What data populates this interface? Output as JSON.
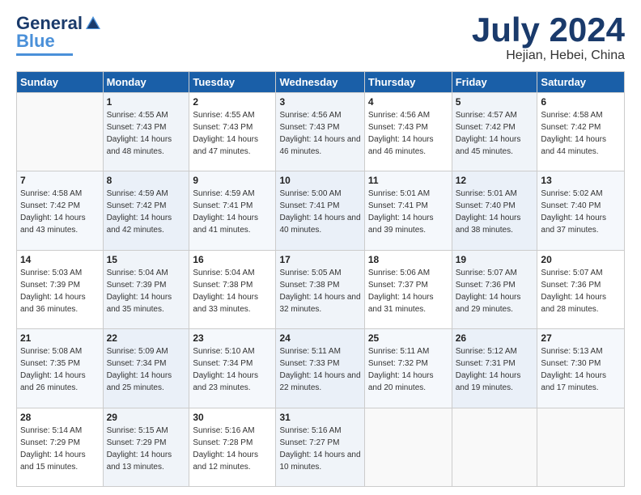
{
  "logo": {
    "line1": "General",
    "line2": "Blue"
  },
  "title": "July 2024",
  "location": "Hejian, Hebei, China",
  "days_header": [
    "Sunday",
    "Monday",
    "Tuesday",
    "Wednesday",
    "Thursday",
    "Friday",
    "Saturday"
  ],
  "weeks": [
    [
      {
        "num": "",
        "sunrise": "",
        "sunset": "",
        "daylight": ""
      },
      {
        "num": "1",
        "sunrise": "Sunrise: 4:55 AM",
        "sunset": "Sunset: 7:43 PM",
        "daylight": "Daylight: 14 hours and 48 minutes."
      },
      {
        "num": "2",
        "sunrise": "Sunrise: 4:55 AM",
        "sunset": "Sunset: 7:43 PM",
        "daylight": "Daylight: 14 hours and 47 minutes."
      },
      {
        "num": "3",
        "sunrise": "Sunrise: 4:56 AM",
        "sunset": "Sunset: 7:43 PM",
        "daylight": "Daylight: 14 hours and 46 minutes."
      },
      {
        "num": "4",
        "sunrise": "Sunrise: 4:56 AM",
        "sunset": "Sunset: 7:43 PM",
        "daylight": "Daylight: 14 hours and 46 minutes."
      },
      {
        "num": "5",
        "sunrise": "Sunrise: 4:57 AM",
        "sunset": "Sunset: 7:42 PM",
        "daylight": "Daylight: 14 hours and 45 minutes."
      },
      {
        "num": "6",
        "sunrise": "Sunrise: 4:58 AM",
        "sunset": "Sunset: 7:42 PM",
        "daylight": "Daylight: 14 hours and 44 minutes."
      }
    ],
    [
      {
        "num": "7",
        "sunrise": "Sunrise: 4:58 AM",
        "sunset": "Sunset: 7:42 PM",
        "daylight": "Daylight: 14 hours and 43 minutes."
      },
      {
        "num": "8",
        "sunrise": "Sunrise: 4:59 AM",
        "sunset": "Sunset: 7:42 PM",
        "daylight": "Daylight: 14 hours and 42 minutes."
      },
      {
        "num": "9",
        "sunrise": "Sunrise: 4:59 AM",
        "sunset": "Sunset: 7:41 PM",
        "daylight": "Daylight: 14 hours and 41 minutes."
      },
      {
        "num": "10",
        "sunrise": "Sunrise: 5:00 AM",
        "sunset": "Sunset: 7:41 PM",
        "daylight": "Daylight: 14 hours and 40 minutes."
      },
      {
        "num": "11",
        "sunrise": "Sunrise: 5:01 AM",
        "sunset": "Sunset: 7:41 PM",
        "daylight": "Daylight: 14 hours and 39 minutes."
      },
      {
        "num": "12",
        "sunrise": "Sunrise: 5:01 AM",
        "sunset": "Sunset: 7:40 PM",
        "daylight": "Daylight: 14 hours and 38 minutes."
      },
      {
        "num": "13",
        "sunrise": "Sunrise: 5:02 AM",
        "sunset": "Sunset: 7:40 PM",
        "daylight": "Daylight: 14 hours and 37 minutes."
      }
    ],
    [
      {
        "num": "14",
        "sunrise": "Sunrise: 5:03 AM",
        "sunset": "Sunset: 7:39 PM",
        "daylight": "Daylight: 14 hours and 36 minutes."
      },
      {
        "num": "15",
        "sunrise": "Sunrise: 5:04 AM",
        "sunset": "Sunset: 7:39 PM",
        "daylight": "Daylight: 14 hours and 35 minutes."
      },
      {
        "num": "16",
        "sunrise": "Sunrise: 5:04 AM",
        "sunset": "Sunset: 7:38 PM",
        "daylight": "Daylight: 14 hours and 33 minutes."
      },
      {
        "num": "17",
        "sunrise": "Sunrise: 5:05 AM",
        "sunset": "Sunset: 7:38 PM",
        "daylight": "Daylight: 14 hours and 32 minutes."
      },
      {
        "num": "18",
        "sunrise": "Sunrise: 5:06 AM",
        "sunset": "Sunset: 7:37 PM",
        "daylight": "Daylight: 14 hours and 31 minutes."
      },
      {
        "num": "19",
        "sunrise": "Sunrise: 5:07 AM",
        "sunset": "Sunset: 7:36 PM",
        "daylight": "Daylight: 14 hours and 29 minutes."
      },
      {
        "num": "20",
        "sunrise": "Sunrise: 5:07 AM",
        "sunset": "Sunset: 7:36 PM",
        "daylight": "Daylight: 14 hours and 28 minutes."
      }
    ],
    [
      {
        "num": "21",
        "sunrise": "Sunrise: 5:08 AM",
        "sunset": "Sunset: 7:35 PM",
        "daylight": "Daylight: 14 hours and 26 minutes."
      },
      {
        "num": "22",
        "sunrise": "Sunrise: 5:09 AM",
        "sunset": "Sunset: 7:34 PM",
        "daylight": "Daylight: 14 hours and 25 minutes."
      },
      {
        "num": "23",
        "sunrise": "Sunrise: 5:10 AM",
        "sunset": "Sunset: 7:34 PM",
        "daylight": "Daylight: 14 hours and 23 minutes."
      },
      {
        "num": "24",
        "sunrise": "Sunrise: 5:11 AM",
        "sunset": "Sunset: 7:33 PM",
        "daylight": "Daylight: 14 hours and 22 minutes."
      },
      {
        "num": "25",
        "sunrise": "Sunrise: 5:11 AM",
        "sunset": "Sunset: 7:32 PM",
        "daylight": "Daylight: 14 hours and 20 minutes."
      },
      {
        "num": "26",
        "sunrise": "Sunrise: 5:12 AM",
        "sunset": "Sunset: 7:31 PM",
        "daylight": "Daylight: 14 hours and 19 minutes."
      },
      {
        "num": "27",
        "sunrise": "Sunrise: 5:13 AM",
        "sunset": "Sunset: 7:30 PM",
        "daylight": "Daylight: 14 hours and 17 minutes."
      }
    ],
    [
      {
        "num": "28",
        "sunrise": "Sunrise: 5:14 AM",
        "sunset": "Sunset: 7:29 PM",
        "daylight": "Daylight: 14 hours and 15 minutes."
      },
      {
        "num": "29",
        "sunrise": "Sunrise: 5:15 AM",
        "sunset": "Sunset: 7:29 PM",
        "daylight": "Daylight: 14 hours and 13 minutes."
      },
      {
        "num": "30",
        "sunrise": "Sunrise: 5:16 AM",
        "sunset": "Sunset: 7:28 PM",
        "daylight": "Daylight: 14 hours and 12 minutes."
      },
      {
        "num": "31",
        "sunrise": "Sunrise: 5:16 AM",
        "sunset": "Sunset: 7:27 PM",
        "daylight": "Daylight: 14 hours and 10 minutes."
      },
      {
        "num": "",
        "sunrise": "",
        "sunset": "",
        "daylight": ""
      },
      {
        "num": "",
        "sunrise": "",
        "sunset": "",
        "daylight": ""
      },
      {
        "num": "",
        "sunrise": "",
        "sunset": "",
        "daylight": ""
      }
    ]
  ]
}
